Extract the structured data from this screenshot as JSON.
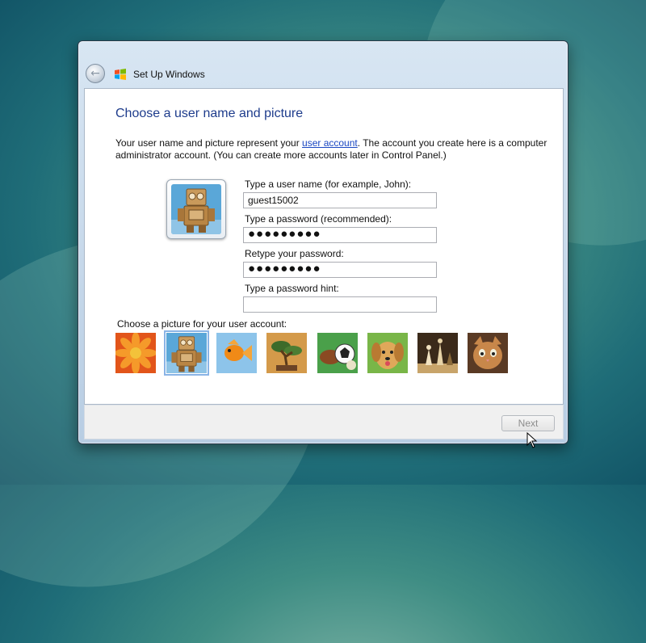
{
  "window": {
    "title": "Set Up Windows"
  },
  "page": {
    "heading": "Choose a user name and picture",
    "desc_before_link": "Your user name and picture represent your ",
    "desc_link": "user account",
    "desc_after_link": ". The account you create here is a computer administrator account. (You can create more accounts later in Control Panel.)"
  },
  "form": {
    "username_label": "Type a user name (for example, John):",
    "username_value": "guest15002",
    "password_label": "Type a password (recommended):",
    "password_value": "●●●●●●●●●",
    "retype_label": "Retype your password:",
    "retype_value": "●●●●●●●●●",
    "hint_label": "Type a password hint:",
    "hint_value": ""
  },
  "pictures": {
    "label": "Choose a picture for your user account:",
    "items": [
      "flower",
      "robot",
      "fish",
      "bonsai",
      "sports-balls",
      "puppy",
      "chess",
      "kitten"
    ],
    "selected": "robot"
  },
  "footer": {
    "next_label": "Next",
    "next_enabled": false
  },
  "colors": {
    "heading": "#1e3c8c",
    "link": "#1a47c2",
    "selection": "#8ab4e6"
  }
}
